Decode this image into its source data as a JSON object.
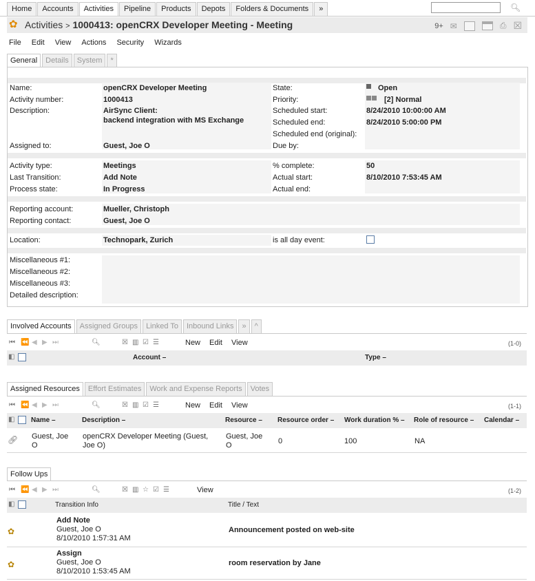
{
  "nav": {
    "tabs": [
      "Home",
      "Accounts",
      "Activities",
      "Pipeline",
      "Products",
      "Depots",
      "Folders & Documents",
      "»"
    ],
    "active_index": 2
  },
  "search": {
    "value": ""
  },
  "header": {
    "breadcrumb": "Activities",
    "separator": ">",
    "title": "1000413: openCRX Developer Meeting - Meeting",
    "badge": "9+"
  },
  "menu": [
    "File",
    "Edit",
    "View",
    "Actions",
    "Security",
    "Wizards"
  ],
  "detail_tabs": [
    "General",
    "Details",
    "System",
    "*"
  ],
  "fields": {
    "name_label": "Name:",
    "name": "openCRX Developer Meeting",
    "number_label": "Activity number:",
    "number": "1000413",
    "description_label": "Description:",
    "description_line1": "AirSync Client:",
    "description_line2": "backend integration with MS Exchange",
    "assigned_label": "Assigned to:",
    "assigned": "Guest, Joe O",
    "state_label": "State:",
    "state": "Open",
    "priority_label": "Priority:",
    "priority": "[2] Normal",
    "sched_start_label": "Scheduled start:",
    "sched_start": "8/24/2010 10:00:00 AM",
    "sched_end_label": "Scheduled end:",
    "sched_end": "8/24/2010 5:00:00 PM",
    "sched_end_orig_label": "Scheduled end (original):",
    "due_label": "Due by:",
    "type_label": "Activity type:",
    "type": "Meetings",
    "last_trans_label": "Last Transition:",
    "last_trans": "Add Note",
    "process_label": "Process state:",
    "process": "In Progress",
    "complete_label": "% complete:",
    "complete": "50",
    "actual_start_label": "Actual start:",
    "actual_start": "8/10/2010 7:53:45 AM",
    "actual_end_label": "Actual end:",
    "rep_account_label": "Reporting account:",
    "rep_account": "Mueller, Christoph",
    "rep_contact_label": "Reporting contact:",
    "rep_contact": "Guest, Joe O",
    "location_label": "Location:",
    "location": "Technopark, Zurich",
    "allday_label": "is all day event:",
    "misc1_label": "Miscellaneous #1:",
    "misc2_label": "Miscellaneous #2:",
    "misc3_label": "Miscellaneous #3:",
    "detailed_label": "Detailed description:"
  },
  "involved": {
    "tabs": [
      "Involved Accounts",
      "Assigned Groups",
      "Linked To",
      "Inbound Links",
      "»",
      "^"
    ],
    "actions": [
      "New",
      "Edit",
      "View"
    ],
    "count": "(1-0)",
    "columns": [
      "Account",
      "Type"
    ]
  },
  "resources": {
    "tabs": [
      "Assigned Resources",
      "Effort Estimates",
      "Work and Expense Reports",
      "Votes"
    ],
    "actions": [
      "New",
      "Edit",
      "View"
    ],
    "count": "(1-1)",
    "columns": [
      "Name",
      "Description",
      "Resource",
      "Resource order",
      "Work duration %",
      "Role of resource",
      "Calendar"
    ],
    "row": {
      "name1": "Guest, Joe",
      "name2": "O",
      "desc1": "openCRX Developer Meeting (Guest,",
      "desc2": "Joe O)",
      "res1": "Guest, Joe",
      "res2": "O",
      "order": "0",
      "duration": "100",
      "role": "NA"
    }
  },
  "followups": {
    "tabs": [
      "Follow Ups"
    ],
    "actions": [
      "View"
    ],
    "count": "(1-2)",
    "columns": [
      "Transition Info",
      "Title / Text"
    ],
    "rows": [
      {
        "transition": "Add Note",
        "user": "Guest, Joe O",
        "time": "8/10/2010 1:57:31 AM",
        "title": "Announcement posted on web-site"
      },
      {
        "transition": "Assign",
        "user": "Guest, Joe O",
        "time": "8/10/2010 1:53:45 AM",
        "title": "room reservation by Jane"
      }
    ]
  }
}
